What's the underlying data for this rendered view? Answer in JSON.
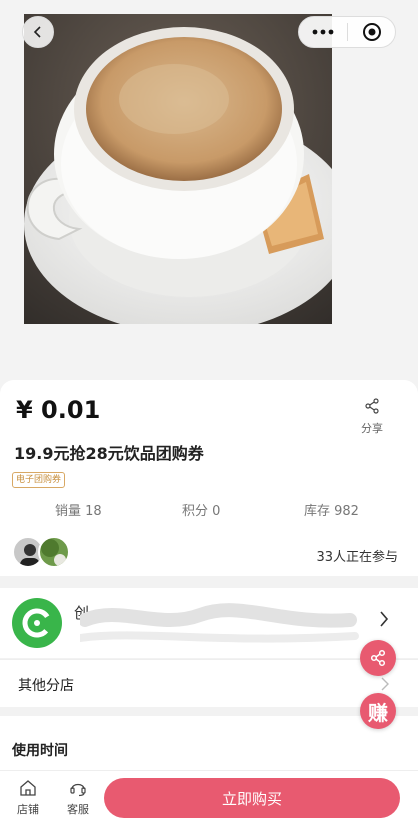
{
  "product": {
    "price": "¥ 0.01",
    "share_label": "分享",
    "title": "19.9元抢28元饮品团购券",
    "tag": "电子团购券",
    "stats": {
      "sales": "销量 18",
      "points": "积分 0",
      "stock": "库存 982"
    },
    "participants_text": "33人正在参与"
  },
  "store": {
    "name": "创"
  },
  "branch": {
    "label": "其他分店"
  },
  "usage": {
    "title": "使用时间"
  },
  "floating": {
    "earn_label": "赚"
  },
  "bottom_bar": {
    "shop_label": "店铺",
    "service_label": "客服",
    "buy_label": "立即购买"
  },
  "colors": {
    "accent": "#e85a70",
    "store_logo": "#39b54a",
    "tag": "#c8903f"
  }
}
